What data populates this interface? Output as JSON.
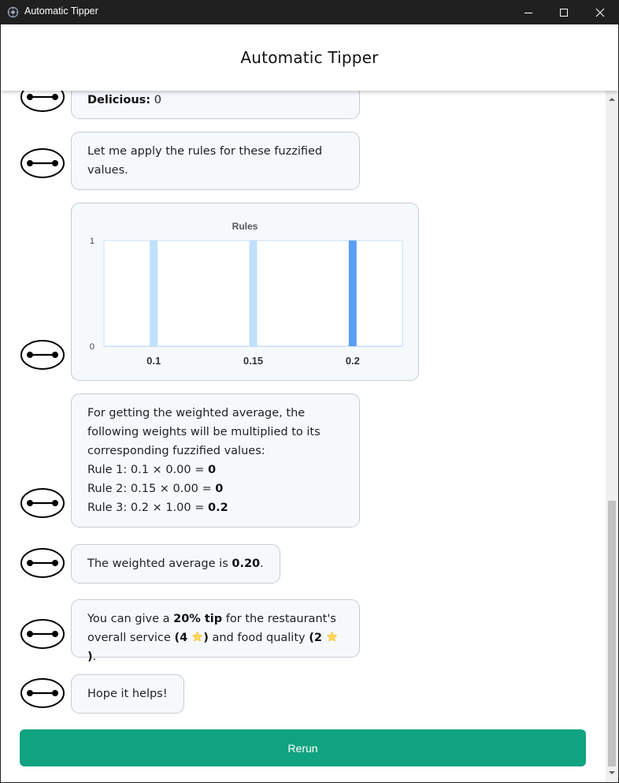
{
  "window": {
    "title": "Automatic Tipper"
  },
  "header": {
    "title": "Automatic Tipper"
  },
  "messages": {
    "m1": {
      "label": "Delicious:",
      "value": "0"
    },
    "m2": {
      "text": "Let me apply the rules for these fuzzified values."
    },
    "m4": {
      "intro": "For getting the weighted average, the following weights will be multiplied to its corresponding fuzzified values:",
      "rules": [
        {
          "expr": "Rule 1: 0.1 × 0.00 = ",
          "result": "0"
        },
        {
          "expr": "Rule 2: 0.15 × 0.00 = ",
          "result": "0"
        },
        {
          "expr": "Rule 3: 0.2 × 1.00 = ",
          "result": "0.2"
        }
      ]
    },
    "m5": {
      "prefix": "The weighted average is ",
      "value": "0.20",
      "suffix": "."
    },
    "m6": {
      "p1": "You can give a ",
      "tip": "20% tip",
      "p2": " for the restaurant's overall service ",
      "service_open": "(4 ",
      "service_close": ")",
      "p3": " and food quality ",
      "food_open": "(2 ",
      "food_close": ")",
      "p4": "."
    },
    "m7": {
      "text": "Hope it helps!"
    }
  },
  "chart_data": {
    "type": "bar",
    "title": "Rules",
    "categories": [
      "0.1",
      "0.15",
      "0.2"
    ],
    "values": [
      1,
      1,
      1
    ],
    "series_colors": [
      "#bfe1fb",
      "#bfe1fb",
      "#5b9ff5"
    ],
    "ylim": [
      0,
      1
    ],
    "yticks": [
      "0",
      "1"
    ]
  },
  "icons": {
    "star": "star-icon",
    "avatar": "robot-face-icon"
  },
  "colors": {
    "accent": "#10a37f",
    "bubble_bg": "#f6f9fc",
    "bar_active": "#5b9ff5",
    "bar_inactive": "#bfe1fb"
  },
  "buttons": {
    "rerun": "Rerun"
  }
}
